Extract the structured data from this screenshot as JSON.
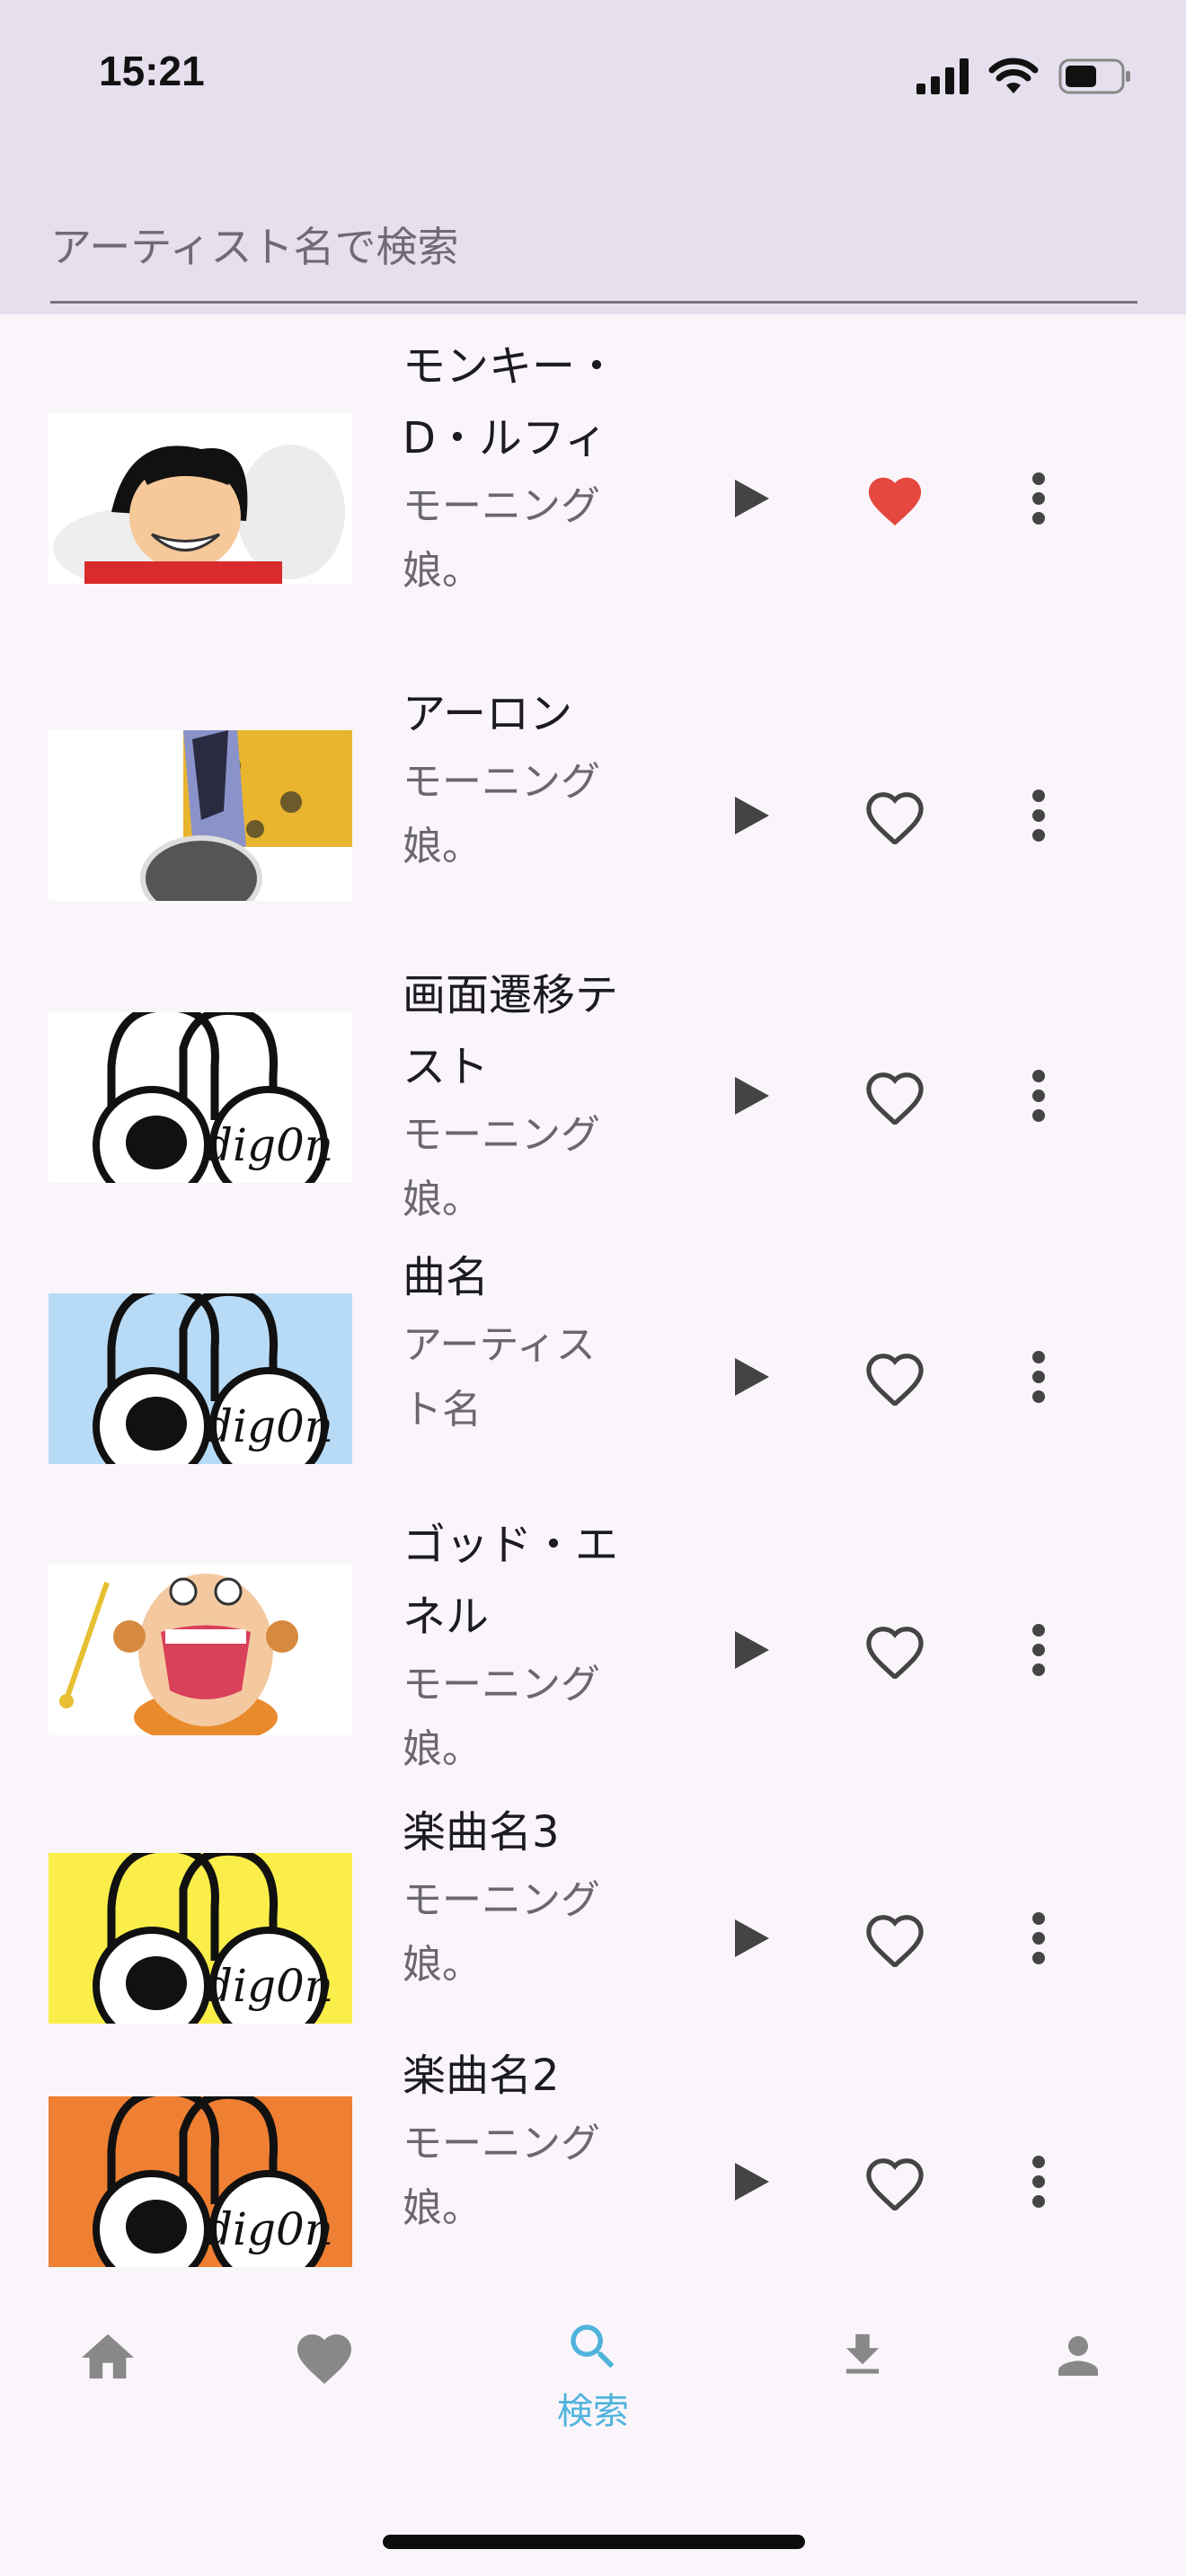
{
  "status_bar": {
    "time": "15:21"
  },
  "search": {
    "placeholder": "アーティスト名で検索"
  },
  "songs": [
    {
      "title": "モンキー・D・ルフィ",
      "artist": "モーニング娘。",
      "favorite": true
    },
    {
      "title": "アーロン",
      "artist": "モーニング娘。",
      "favorite": false
    },
    {
      "title": "画面遷移テスト",
      "artist": "モーニング娘。",
      "favorite": false
    },
    {
      "title": "曲名",
      "artist": "アーティスト名",
      "favorite": false
    },
    {
      "title": "ゴッド・エネル",
      "artist": "モーニング娘。",
      "favorite": false
    },
    {
      "title": "楽曲名3",
      "artist": "モーニング娘。",
      "favorite": false
    },
    {
      "title": "楽曲名2",
      "artist": "モーニング娘。",
      "favorite": false
    }
  ],
  "bottom_nav": {
    "items": [
      {
        "icon": "home-icon"
      },
      {
        "icon": "heart-icon"
      },
      {
        "icon": "search-icon",
        "label": "検索",
        "active": true
      },
      {
        "icon": "download-icon"
      },
      {
        "icon": "person-icon"
      }
    ]
  },
  "colors": {
    "header_bg": "#e6e0ee",
    "body_bg": "#faf5fb",
    "active": "#4fb3dc",
    "favorite": "#e5483f",
    "icon": "#444444"
  }
}
